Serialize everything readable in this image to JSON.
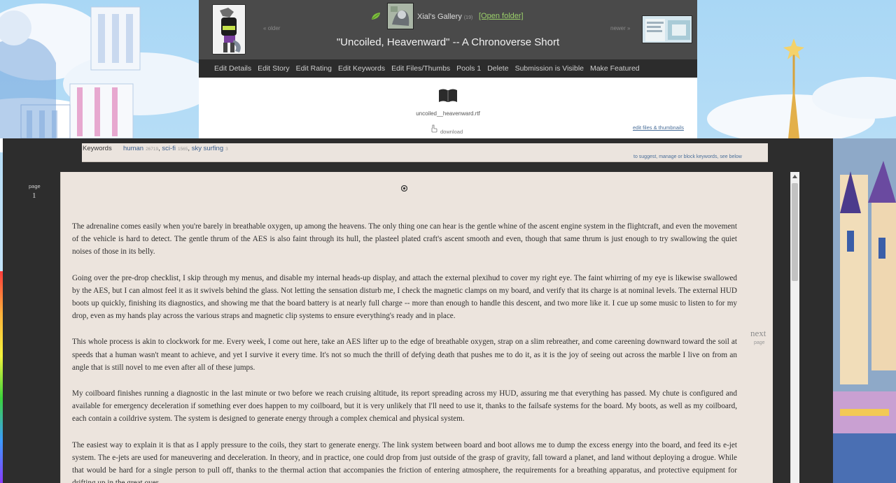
{
  "header": {
    "gallery_name": "Xial's Gallery",
    "gallery_count": "(19)",
    "open_folder": "[Open folder]",
    "older_label": "« older",
    "newer_label": "newer »",
    "title": "\"Uncoiled, Heavenward\" -- A Chronoverse Short"
  },
  "toolbar": {
    "items": [
      "Edit Details",
      "Edit Story",
      "Edit Rating",
      "Edit Keywords",
      "Edit Files/Thumbs",
      "Pools 1",
      "Delete",
      "Submission is Visible",
      "Make Featured"
    ]
  },
  "file": {
    "name": "uncoiled__heavenward.rtf",
    "download": "download",
    "edit_link": "edit files & thumbnails"
  },
  "keywords": {
    "label": "Keywords",
    "items": [
      {
        "name": "human",
        "count": "26719"
      },
      {
        "name": "sci-fi",
        "count": "1565"
      },
      {
        "name": "sky surfing",
        "count": "3"
      }
    ],
    "manage": "to suggest, manage or block keywords, see below"
  },
  "pager": {
    "page_label": "page",
    "page_number": "1",
    "next": "next",
    "next_sub": "page"
  },
  "story": {
    "paragraphs": [
      "The adrenaline comes easily when you're barely in breathable oxygen, up among the heavens. The only thing one can hear is the gentle whine of the ascent engine system in the flightcraft, and even the movement of the vehicle is hard to detect. The gentle thrum of the AES is also faint through its hull, the plasteel plated craft's ascent smooth and even, though that same thrum is just enough to try swallowing the quiet noises of those in its belly.",
      "Going over the pre-drop checklist, I skip through my menus, and disable my internal heads-up display, and attach the external plexihud to cover my right eye. The faint whirring of my eye is likewise swallowed by the AES, but I can almost feel it as it swivels behind the glass. Not letting the sensation disturb me, I check the magnetic clamps on my board, and verify that its charge is at nominal levels. The external HUD boots up quickly, finishing its diagnostics, and showing me that the board battery is at nearly full charge -- more than enough to handle this descent, and two more like it. I cue up some music to listen to for my drop, even as my hands play across the various straps and magnetic clip systems to ensure everything's ready and in place.",
      "This whole process is akin to clockwork for me. Every week, I come out here, take an AES lifter up to the edge of breathable oxygen, strap on a slim rebreather, and come careening downward toward the soil at speeds that a human wasn't meant to achieve, and yet I survive it every time. It's not so much the thrill of defying death that pushes me to do it, as it is the joy of seeing out across the marble I live on from an angle that is still novel to me even after all of these jumps.",
      "My coilboard finishes running a diagnostic in the last minute or two before we reach cruising altitude, its report spreading across my HUD, assuring me that everything has passed. My chute is configured and available for emergency deceleration if something ever does happen to my coilboard, but it is very unlikely that I'll need to use it, thanks to the failsafe systems for the board. My boots, as well as my coilboard, each contain a coildrive system. The system is designed to generate energy through a complex chemical and physical system.",
      "The easiest way to explain it is that as I apply pressure to the coils, they start to generate energy. The link system between board and boot allows me to dump the excess energy into the board, and feed its e-jet system. The e-jets are used for maneuvering and deceleration. In theory, and in practice, one could drop from just outside of the grasp of gravity, fall toward a planet, and land without deploying a drogue. While that would be hard for a single person to pull off, thanks to the thermal action that accompanies the friction of entering atmosphere, the requirements for a breathing apparatus, and protective equipment for drifting up in the great over..."
    ]
  }
}
